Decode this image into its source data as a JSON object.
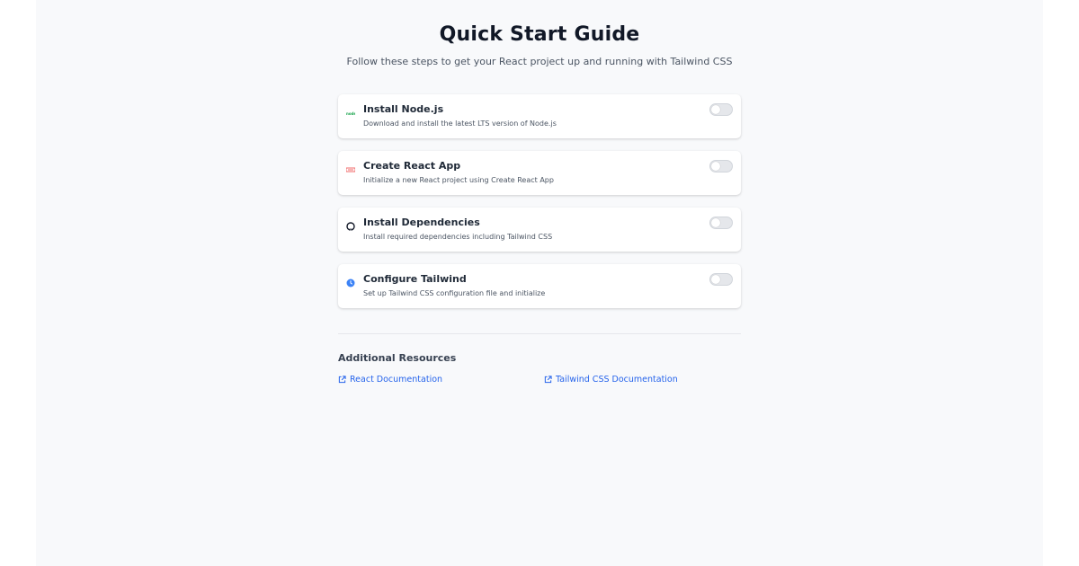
{
  "header": {
    "title": "Quick Start Guide",
    "subtitle": "Follow these steps to get your React project up and running with Tailwind CSS"
  },
  "steps": [
    {
      "title": "Install Node.js",
      "description": "Download and install the latest LTS version of Node.js",
      "icon": "nodejs-icon",
      "icon_color": "#16a34a",
      "completed": false
    },
    {
      "title": "Create React App",
      "description": "Initialize a new React project using Create React App",
      "icon": "react-icon",
      "icon_color": "#ef4444",
      "completed": false
    },
    {
      "title": "Install Dependencies",
      "description": "Install required dependencies including Tailwind CSS",
      "icon": "github-icon",
      "icon_color": "#111827",
      "completed": false
    },
    {
      "title": "Configure Tailwind",
      "description": "Set up Tailwind CSS configuration file and initialize",
      "icon": "clock-icon",
      "icon_color": "#3b82f6",
      "completed": false
    }
  ],
  "resources": {
    "title": "Additional Resources",
    "links": [
      {
        "label": "React Documentation",
        "icon": "external-link-icon"
      },
      {
        "label": "Tailwind CSS Documentation",
        "icon": "external-link-icon"
      }
    ]
  },
  "colors": {
    "background": "#f8f9fb",
    "card": "#ffffff",
    "link": "#2563eb",
    "toggle_off": "#e5e7eb"
  }
}
